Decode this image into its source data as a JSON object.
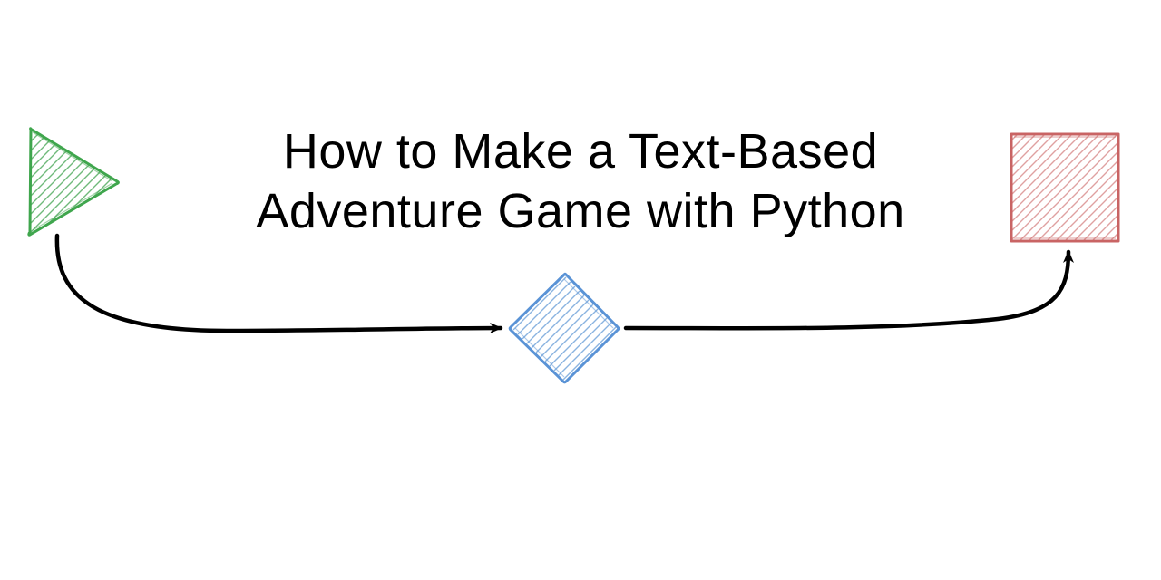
{
  "title": {
    "line1": "How to Make a Text-Based",
    "line2": "Adventure Game with Python"
  },
  "shapes": {
    "triangle": {
      "stroke": "#3fa64d",
      "fill": "#bfe3c1"
    },
    "diamond": {
      "stroke": "#5a93d6",
      "fill": "#cfe0f4"
    },
    "square": {
      "stroke": "#c96464",
      "fill": "#efc6c6"
    },
    "arrow": {
      "stroke": "#000000"
    }
  }
}
